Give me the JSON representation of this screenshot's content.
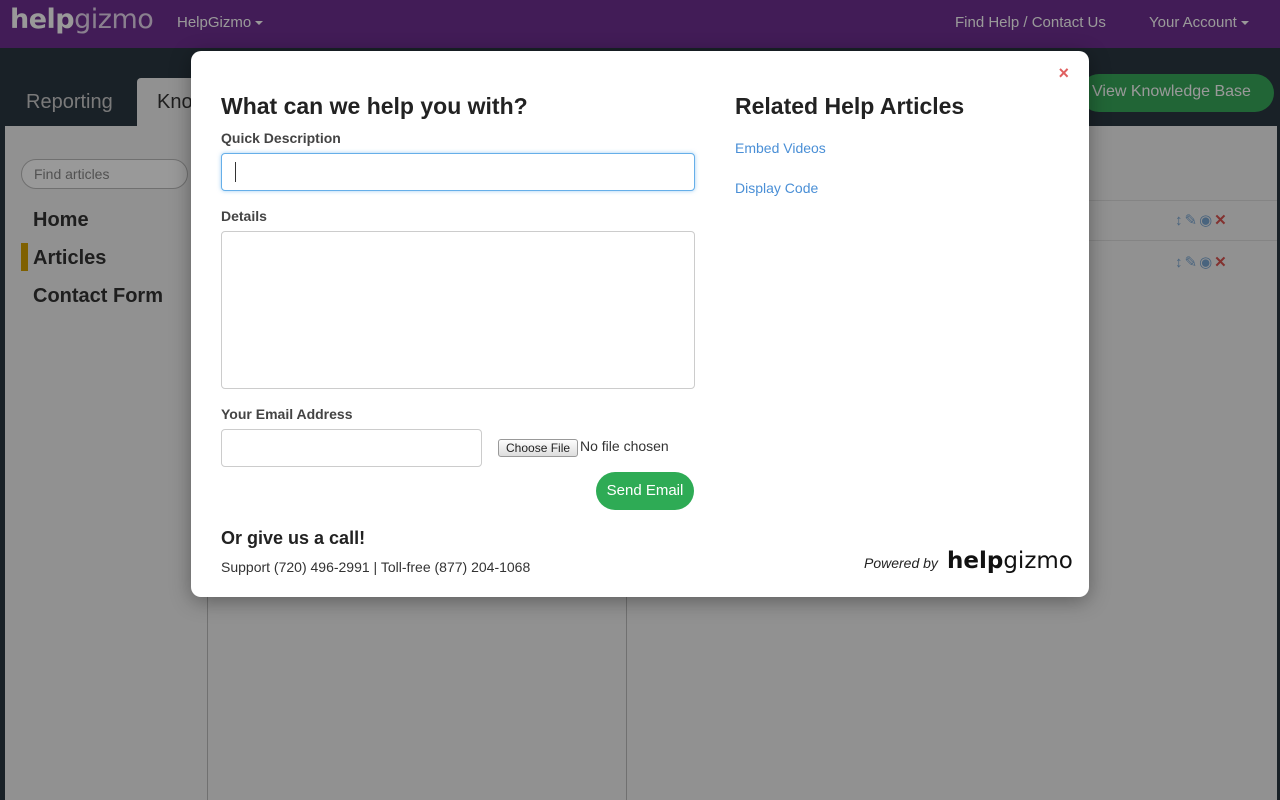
{
  "header": {
    "logo_bold": "help",
    "logo_light": "gizmo",
    "org_menu": "HelpGizmo",
    "find_help": "Find Help / Contact Us",
    "account": "Your Account"
  },
  "tabs": [
    "Reporting",
    "Kno"
  ],
  "view_kb": "View Knowledge Base",
  "sidebar": {
    "search_placeholder": "Find articles",
    "items": [
      "Home",
      "Articles",
      "Contact Form"
    ]
  },
  "modal": {
    "close": "×",
    "title": "What can we help you with?",
    "quick_label": "Quick Description",
    "quick_value": "",
    "details_label": "Details",
    "details_value": "",
    "email_label": "Your Email Address",
    "email_value": "",
    "choose_file": "Choose File",
    "no_file": "No file chosen",
    "send": "Send Email",
    "call_title": "Or give us a call!",
    "call_text": "Support (720) 496-2991 | Toll-free (877) 204-1068",
    "related_title": "Related Help Articles",
    "related_links": [
      "Embed Videos",
      "Display Code"
    ],
    "powered_by": "Powered by",
    "powered_logo_bold": "help",
    "powered_logo_light": "gizmo"
  }
}
